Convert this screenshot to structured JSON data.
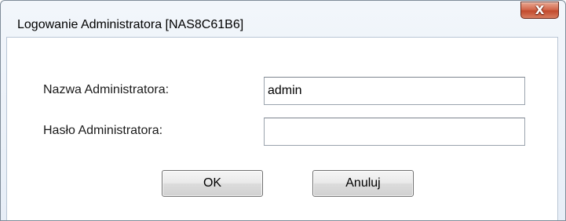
{
  "window": {
    "title": "Logowanie Administratora [NAS8C61B6]",
    "close_glyph": "X",
    "close_icon": "close-icon",
    "accent_close_color": "#c24a2d"
  },
  "form": {
    "username_label": "Nazwa Administratora:",
    "username_value": "admin",
    "password_label": "Hasło Administratora:",
    "password_value": ""
  },
  "buttons": {
    "ok_label": "OK",
    "cancel_label": "Anuluj"
  }
}
